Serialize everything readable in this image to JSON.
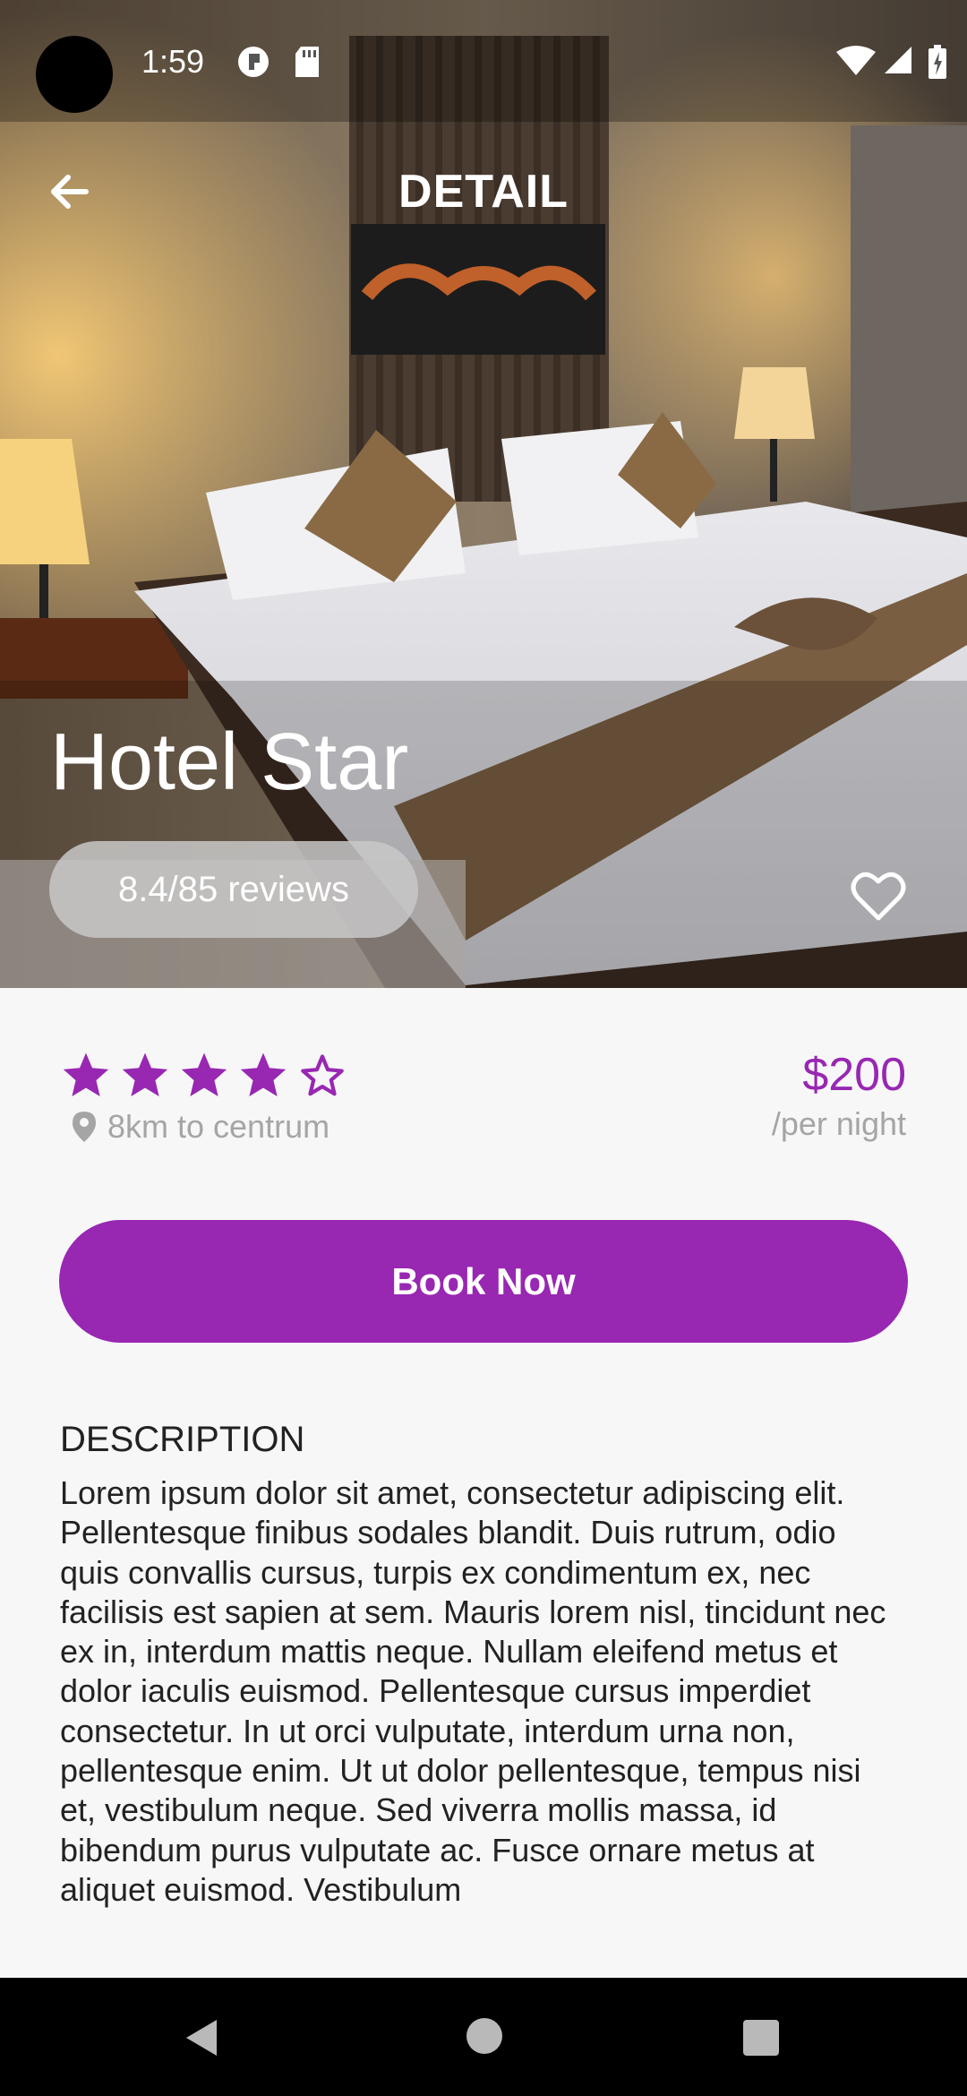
{
  "status_bar": {
    "time": "1:59"
  },
  "app_bar": {
    "title": "DETAIL"
  },
  "hotel": {
    "name": "Hotel Star",
    "reviews_label": "8.4/85 reviews",
    "rating_stars": 4,
    "rating_max": 5,
    "distance": "8km to centrum",
    "price": "$200",
    "price_unit": "/per night"
  },
  "actions": {
    "book_label": "Book Now"
  },
  "description": {
    "title": "DESCRIPTION",
    "body": "Lorem ipsum dolor sit amet, consectetur adipiscing elit. Pellentesque finibus sodales blandit. Duis rutrum, odio quis convallis cursus, turpis ex condimentum ex, nec facilisis est sapien at sem. Mauris lorem nisl, tincidunt nec ex in, interdum mattis neque. Nullam eleifend metus et dolor iaculis euismod. Pellentesque cursus imperdiet consectetur. In ut orci vulputate, interdum urna non, pellentesque enim. Ut ut dolor pellentesque, tempus nisi et, vestibulum neque. Sed viverra mollis massa, id bibendum purus vulputate ac. Fusce ornare metus at aliquet euismod. Vestibulum"
  },
  "colors": {
    "accent": "#9827b2",
    "muted_text": "#a5a5a5"
  },
  "icons": [
    "arrow-back-icon",
    "heart-outline-icon",
    "star-icon",
    "star-outline-icon",
    "location-pin-icon",
    "nav-back-icon",
    "nav-home-icon",
    "nav-recents-icon"
  ]
}
